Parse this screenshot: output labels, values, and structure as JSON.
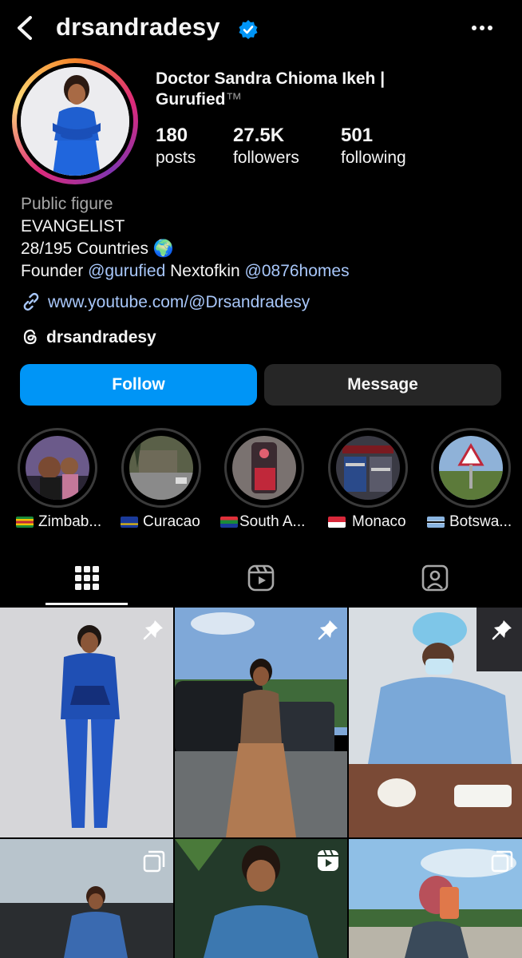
{
  "header": {
    "username": "drsandradesy",
    "verified": true,
    "back_icon": "chevron-left-icon",
    "more_icon": "more-horizontal-icon"
  },
  "profile": {
    "full_name_line1": "Doctor Sandra Chioma Ikeh |",
    "full_name_line2": "Gurufied",
    "trademark": "™",
    "stats": {
      "posts_count": "180",
      "posts_label": "posts",
      "followers_count": "27.5K",
      "followers_label": "followers",
      "following_count": "501",
      "following_label": "following"
    },
    "category": "Public figure",
    "bio_line1": "EVANGELIST",
    "bio_line2": "28/195 Countries 🌍",
    "bio_line3_prefix": "Founder",
    "bio_mention1": "@gurufied",
    "bio_line3_middle": "Nextofkin",
    "bio_mention2": "@0876homes",
    "link": "www.youtube.com/@Drsandradesy",
    "threads_handle": "drsandradesy"
  },
  "actions": {
    "follow": "Follow",
    "message": "Message"
  },
  "highlights": [
    {
      "label": "Zimbab..."
    },
    {
      "label": "Curacao"
    },
    {
      "label": "South A..."
    },
    {
      "label": "Monaco"
    },
    {
      "label": "Botswa..."
    }
  ],
  "tabs": [
    {
      "name": "posts-grid",
      "icon": "grid-icon",
      "selected": true
    },
    {
      "name": "reels",
      "icon": "reels-icon",
      "selected": false
    },
    {
      "name": "tagged",
      "icon": "tagged-user-icon",
      "selected": false
    }
  ],
  "colors": {
    "background": "#000000",
    "follow_button": "#0095f6",
    "message_button": "#262626",
    "link": "#a8c7fa",
    "verified_badge": "#0095f6"
  },
  "grid": [
    {
      "type": "pinned",
      "icon": "pin-icon"
    },
    {
      "type": "pinned",
      "icon": "pin-icon"
    },
    {
      "type": "pinned",
      "icon": "pin-icon"
    },
    {
      "type": "carousel",
      "icon": "carousel-icon"
    },
    {
      "type": "reel",
      "icon": "reels-icon"
    },
    {
      "type": "carousel",
      "icon": "carousel-icon"
    }
  ]
}
